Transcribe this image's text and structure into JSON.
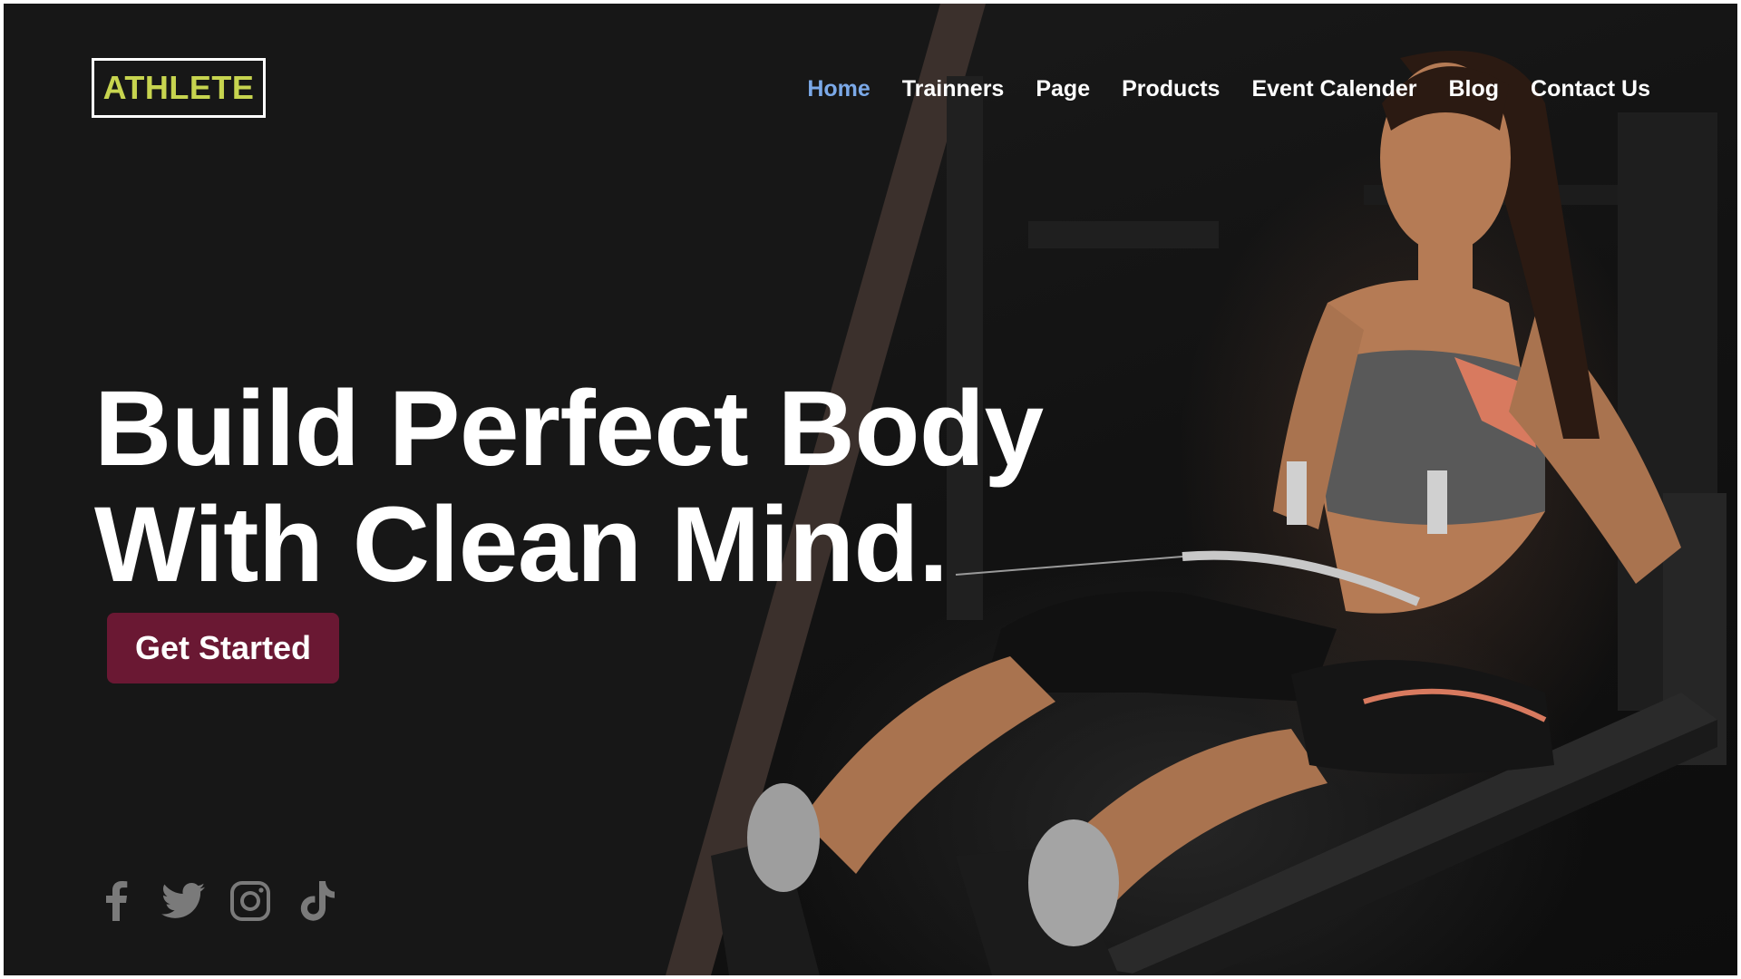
{
  "brand": {
    "logo_text": "ATHLETE"
  },
  "nav": {
    "items": [
      {
        "label": "Home",
        "active": true
      },
      {
        "label": "Trainners",
        "active": false
      },
      {
        "label": "Page",
        "active": false
      },
      {
        "label": "Products",
        "active": false
      },
      {
        "label": "Event Calender",
        "active": false
      },
      {
        "label": "Blog",
        "active": false
      },
      {
        "label": "Contact Us",
        "active": false
      }
    ]
  },
  "hero": {
    "title_line1": "Build Perfect Body",
    "title_line2": "With Clean Mind.",
    "cta_label": "Get Started"
  },
  "social": {
    "icons": [
      "facebook-icon",
      "twitter-icon",
      "instagram-icon",
      "tiktok-icon"
    ]
  },
  "colors": {
    "background": "#171717",
    "logo_text": "#c7d44f",
    "nav_active": "#7ba9e8",
    "cta_background": "#6a1833",
    "diagonal_band": "#3b302c",
    "social_icon": "#7a7a7a"
  }
}
